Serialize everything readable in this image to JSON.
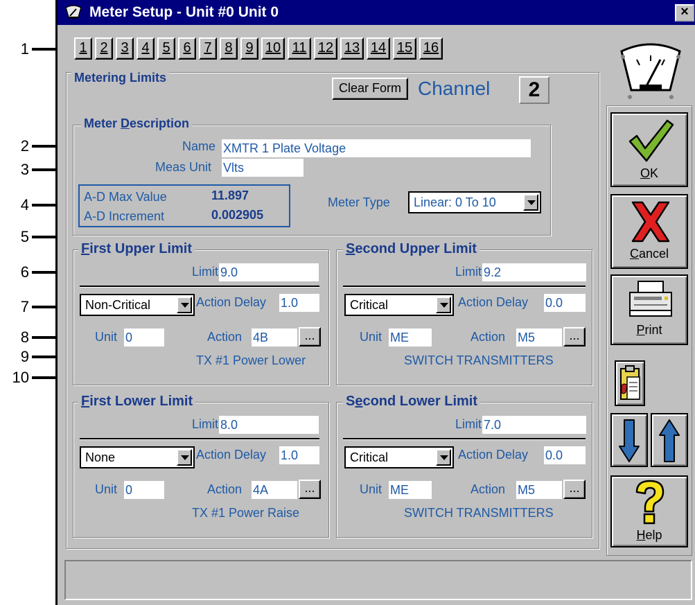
{
  "window": {
    "title": "Meter Setup - Unit #0 Unit 0",
    "close": "×"
  },
  "tabs": [
    "1",
    "2",
    "3",
    "4",
    "5",
    "6",
    "7",
    "8",
    "9",
    "10",
    "11",
    "12",
    "13",
    "14",
    "15",
    "16"
  ],
  "metering": {
    "title": "Metering Limits",
    "clear_form": "Clear Form",
    "channel_label": "Channel",
    "channel_value": "2"
  },
  "meter_description": {
    "title_pre": "Meter ",
    "title_accel": "D",
    "title_post": "escription",
    "name_label": "Name",
    "name_value": "XMTR 1 Plate Voltage",
    "meas_unit_label": "Meas Unit",
    "meas_unit_value": "Vlts",
    "ad_max_label": "A-D Max Value",
    "ad_max_value": "11.897",
    "ad_inc_label": "A-D Increment",
    "ad_inc_value": "0.002905",
    "meter_type_label": "Meter Type",
    "meter_type_value": "Linear: 0 To 10"
  },
  "first_upper": {
    "title_accel": "F",
    "title_rest": "irst Upper Limit",
    "limit_label": "Limit",
    "limit_value": "9.0",
    "severity": "Non-Critical",
    "delay_label": "Action Delay",
    "delay_value": "1.0",
    "unit_label": "Unit",
    "unit_value": "0",
    "action_label": "Action",
    "action_value": "4B",
    "browse": "...",
    "action_desc": "TX #1 Power Lower"
  },
  "second_upper": {
    "title_accel": "S",
    "title_rest": "econd Upper Limit",
    "limit_label": "Limit",
    "limit_value": "9.2",
    "severity": "Critical",
    "delay_label": "Action Delay",
    "delay_value": "0.0",
    "unit_label": "Unit",
    "unit_value": "ME",
    "action_label": "Action",
    "action_value": "M5",
    "browse": "...",
    "action_desc": "SWITCH TRANSMITTERS"
  },
  "first_lower": {
    "title_accel": "F",
    "title_rest": "irst Lower Limit",
    "limit_label": "Limit",
    "limit_value": "8.0",
    "severity": "None",
    "delay_label": "Action Delay",
    "delay_value": "1.0",
    "unit_label": "Unit",
    "unit_value": "0",
    "action_label": "Action",
    "action_value": "4A",
    "browse": "...",
    "action_desc": "TX #1 Power Raise"
  },
  "second_lower": {
    "title_pre": "S",
    "title_accel": "e",
    "title_rest": "cond Lower Limit",
    "limit_label": "Limit",
    "limit_value": "7.0",
    "severity": "Critical",
    "delay_label": "Action Delay",
    "delay_value": "0.0",
    "unit_label": "Unit",
    "unit_value": "ME",
    "action_label": "Action",
    "action_value": "M5",
    "browse": "...",
    "action_desc": "SWITCH TRANSMITTERS"
  },
  "sidebar": {
    "ok_accel": "O",
    "ok_rest": "K",
    "cancel_accel": "C",
    "cancel_rest": "ancel",
    "print_accel": "P",
    "print_rest": "rint",
    "help_accel": "H",
    "help_rest": "elp"
  },
  "callouts": [
    "1",
    "2",
    "3",
    "4",
    "5",
    "6",
    "7",
    "8",
    "9",
    "10"
  ],
  "colors": {
    "title_bar": "#00007f",
    "label_blue": "#1f5aa6",
    "group_title": "#1a3c8c",
    "face": "#c0c0c0"
  }
}
